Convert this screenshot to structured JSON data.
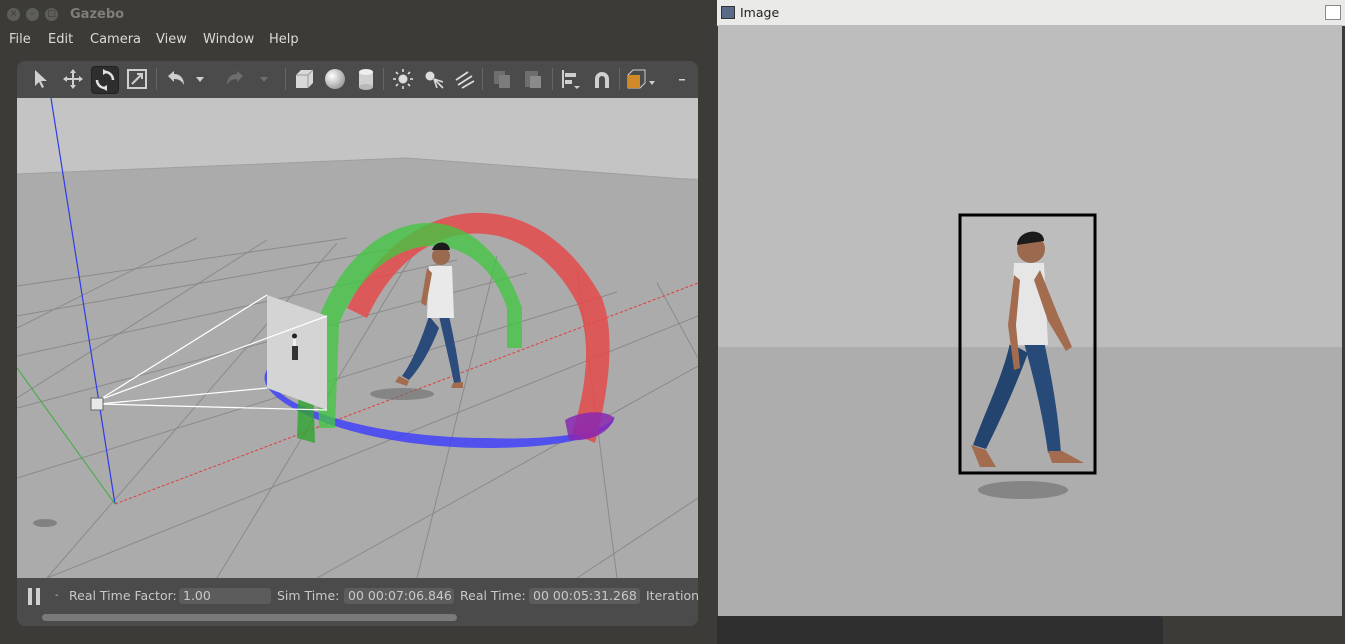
{
  "gazebo": {
    "window_title": "Gazebo",
    "menu": [
      "File",
      "Edit",
      "Camera",
      "View",
      "Window",
      "Help"
    ],
    "toolbar": {
      "tools": [
        "select-tool",
        "translate-tool",
        "rotate-tool",
        "scale-tool",
        "undo",
        "undo-history",
        "redo",
        "redo-history",
        "box-shape",
        "sphere-shape",
        "cylinder-shape",
        "point-light",
        "spot-light",
        "directional-light",
        "copy",
        "paste",
        "align",
        "snap",
        "change-view"
      ],
      "active_tool": "rotate-tool"
    },
    "status": {
      "pause_icon": "pause-icon",
      "step_marker": "-",
      "real_time_factor_label": "Real Time Factor:",
      "real_time_factor": "1.00",
      "sim_time_label": "Sim Time:",
      "sim_time": "00 00:07:06.846",
      "real_time_label": "Real Time:",
      "real_time": "00 00:05:31.268",
      "iterations_label": "Iteration"
    }
  },
  "image_window": {
    "title": "Image"
  },
  "colors": {
    "window_bg": "#3c3b37",
    "menu_text": "#dfdbd2",
    "toolbar_bg": "#4b4b4b",
    "viewport_bg": "#b9b9b9",
    "image_bg": "#bdbdbd"
  }
}
